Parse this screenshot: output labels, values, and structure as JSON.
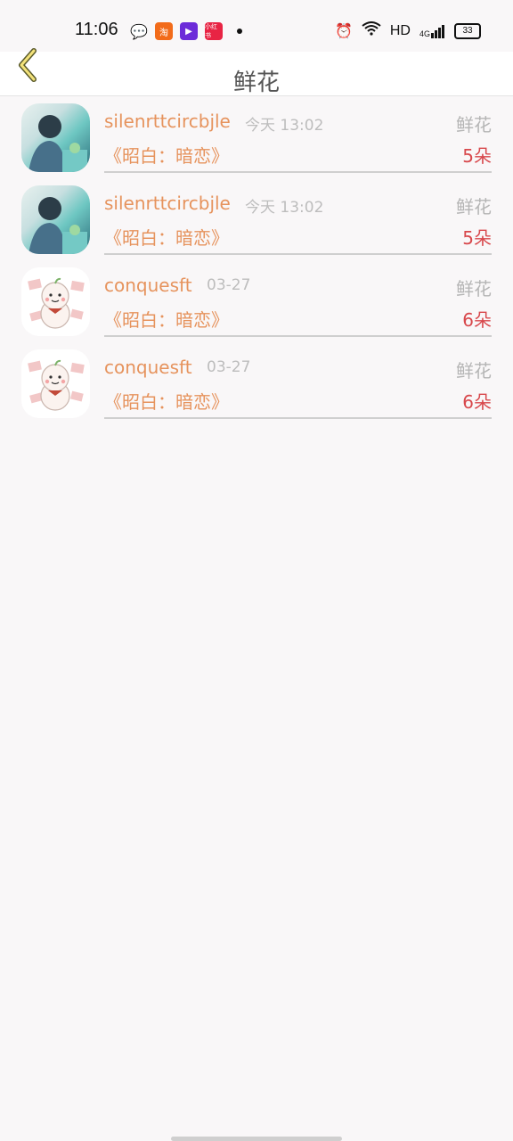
{
  "status_bar": {
    "time": "11:06",
    "notification_icons": [
      "wechat-icon",
      "taobao-icon",
      "video-app-icon",
      "redbook-icon"
    ],
    "taobao_label": "淘",
    "redbook_label": "小红书",
    "system_labels": {
      "network": "HD",
      "signal": "4G",
      "battery": "33"
    }
  },
  "header": {
    "title": "鲜花",
    "back_icon": "chevron-left-icon"
  },
  "colors": {
    "accent_orange": "#e6935d",
    "count_red": "#d8484c",
    "muted_gray": "#b5b5b5"
  },
  "records": [
    {
      "user": "silenrttcircbjle",
      "date": "今天 13:02",
      "type": "鲜花",
      "book": "《昭白：暗恋》",
      "count": "5朵",
      "avatar": "photo-avatar"
    },
    {
      "user": "silenrttcircbjle",
      "date": "今天 13:02",
      "type": "鲜花",
      "book": "《昭白：暗恋》",
      "count": "5朵",
      "avatar": "photo-avatar"
    },
    {
      "user": "conquesft",
      "date": "03-27",
      "type": "鲜花",
      "book": "《昭白：暗恋》",
      "count": "6朵",
      "avatar": "cartoon-avatar"
    },
    {
      "user": "conquesft",
      "date": "03-27",
      "type": "鲜花",
      "book": "《昭白：暗恋》",
      "count": "6朵",
      "avatar": "cartoon-avatar"
    }
  ]
}
